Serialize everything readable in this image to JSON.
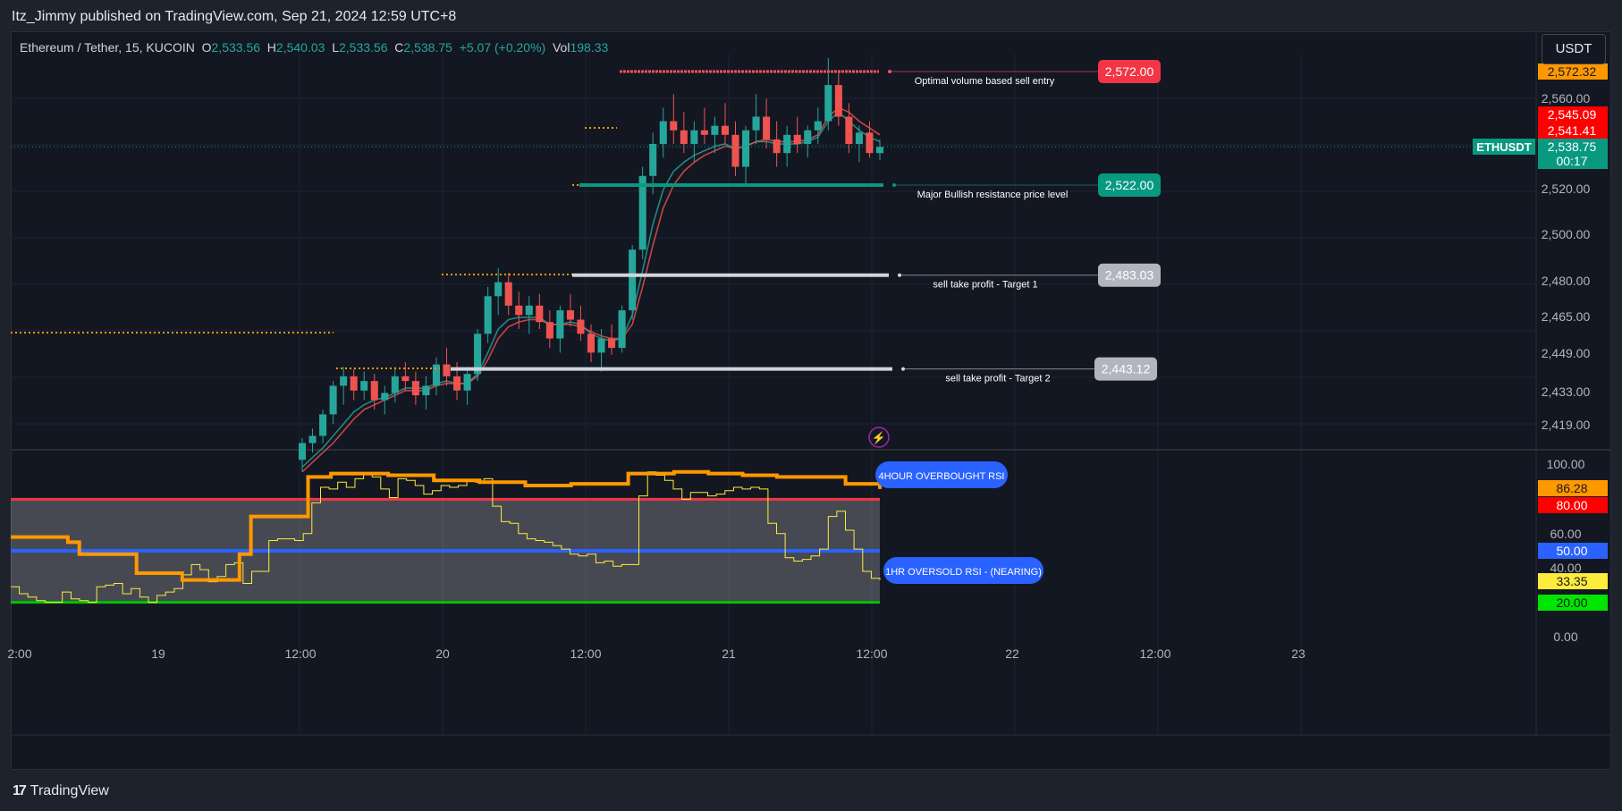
{
  "header": {
    "published": "Itz_Jimmy published on TradingView.com, Sep 21, 2024 12:59 UTC+8"
  },
  "legend": {
    "symbol": "Ethereum / Tether, 15, KUCOIN",
    "o_label": "O",
    "o": "2,533.56",
    "h_label": "H",
    "h": "2,540.03",
    "l_label": "L",
    "l": "2,533.56",
    "c_label": "C",
    "c": "2,538.75",
    "change": "+5.07 (+0.20%)",
    "vol_label": "Vol",
    "vol": "198.33"
  },
  "currency_button": "USDT",
  "symbol_tag": "ETHUSDT",
  "footer": {
    "brand": "TradingView"
  },
  "colors": {
    "up": "#26a69a",
    "down": "#ef5350",
    "orange": "#ff9800",
    "rsi_blue": "#2962ff",
    "rsi_red": "#f23645",
    "rsi_green": "#00c300"
  },
  "chart_data": {
    "type": "candlestick",
    "price_axis": {
      "ticks": [
        "2,560.00",
        "2,520.00",
        "2,500.00",
        "2,480.00",
        "2,465.00",
        "2,449.00",
        "2,433.00",
        "2,419.00"
      ],
      "scale": "log"
    },
    "price_labels": [
      {
        "text": "2,572.32",
        "bg": "#ff9800",
        "fg": "#131722"
      },
      {
        "text": "2,545.09",
        "bg": "#ff0000",
        "fg": "#ffffff"
      },
      {
        "text": "2,541.41",
        "bg": "#ff0000",
        "fg": "#ffffff"
      },
      {
        "text": "2,538.75",
        "bg": "#089981",
        "fg": "#ffffff"
      },
      {
        "text": "00:17",
        "bg": "#089981",
        "fg": "#ffffff"
      }
    ],
    "last_price": 2538.75,
    "time_axis": [
      "2:00",
      "19",
      "12:00",
      "20",
      "12:00",
      "21",
      "12:00",
      "22",
      "12:00",
      "23"
    ],
    "candles": [
      {
        "o": 2405,
        "h": 2414,
        "l": 2400,
        "c": 2412
      },
      {
        "o": 2412,
        "h": 2418,
        "l": 2408,
        "c": 2415
      },
      {
        "o": 2415,
        "h": 2426,
        "l": 2412,
        "c": 2424
      },
      {
        "o": 2424,
        "h": 2438,
        "l": 2420,
        "c": 2436
      },
      {
        "o": 2436,
        "h": 2444,
        "l": 2428,
        "c": 2440
      },
      {
        "o": 2440,
        "h": 2443,
        "l": 2430,
        "c": 2434
      },
      {
        "o": 2434,
        "h": 2442,
        "l": 2430,
        "c": 2438
      },
      {
        "o": 2438,
        "h": 2441,
        "l": 2426,
        "c": 2430
      },
      {
        "o": 2430,
        "h": 2436,
        "l": 2424,
        "c": 2433
      },
      {
        "o": 2433,
        "h": 2444,
        "l": 2429,
        "c": 2440
      },
      {
        "o": 2440,
        "h": 2446,
        "l": 2434,
        "c": 2438
      },
      {
        "o": 2438,
        "h": 2442,
        "l": 2428,
        "c": 2432
      },
      {
        "o": 2432,
        "h": 2440,
        "l": 2426,
        "c": 2436
      },
      {
        "o": 2436,
        "h": 2448,
        "l": 2432,
        "c": 2445
      },
      {
        "o": 2445,
        "h": 2452,
        "l": 2436,
        "c": 2440
      },
      {
        "o": 2440,
        "h": 2446,
        "l": 2430,
        "c": 2434
      },
      {
        "o": 2434,
        "h": 2444,
        "l": 2428,
        "c": 2441
      },
      {
        "o": 2441,
        "h": 2460,
        "l": 2438,
        "c": 2458
      },
      {
        "o": 2458,
        "h": 2478,
        "l": 2454,
        "c": 2474
      },
      {
        "o": 2474,
        "h": 2486,
        "l": 2466,
        "c": 2480
      },
      {
        "o": 2480,
        "h": 2484,
        "l": 2466,
        "c": 2470
      },
      {
        "o": 2470,
        "h": 2476,
        "l": 2460,
        "c": 2466
      },
      {
        "o": 2466,
        "h": 2474,
        "l": 2458,
        "c": 2470
      },
      {
        "o": 2470,
        "h": 2475,
        "l": 2460,
        "c": 2463
      },
      {
        "o": 2463,
        "h": 2468,
        "l": 2452,
        "c": 2456
      },
      {
        "o": 2456,
        "h": 2470,
        "l": 2450,
        "c": 2468
      },
      {
        "o": 2468,
        "h": 2475,
        "l": 2461,
        "c": 2464
      },
      {
        "o": 2464,
        "h": 2470,
        "l": 2455,
        "c": 2458
      },
      {
        "o": 2458,
        "h": 2462,
        "l": 2446,
        "c": 2450
      },
      {
        "o": 2450,
        "h": 2460,
        "l": 2442,
        "c": 2456
      },
      {
        "o": 2456,
        "h": 2462,
        "l": 2449,
        "c": 2452
      },
      {
        "o": 2452,
        "h": 2470,
        "l": 2450,
        "c": 2468
      },
      {
        "o": 2468,
        "h": 2496,
        "l": 2464,
        "c": 2494
      },
      {
        "o": 2494,
        "h": 2530,
        "l": 2490,
        "c": 2526
      },
      {
        "o": 2526,
        "h": 2545,
        "l": 2518,
        "c": 2540
      },
      {
        "o": 2540,
        "h": 2556,
        "l": 2534,
        "c": 2550
      },
      {
        "o": 2550,
        "h": 2562,
        "l": 2540,
        "c": 2546
      },
      {
        "o": 2546,
        "h": 2554,
        "l": 2536,
        "c": 2540
      },
      {
        "o": 2540,
        "h": 2550,
        "l": 2532,
        "c": 2546
      },
      {
        "o": 2546,
        "h": 2556,
        "l": 2540,
        "c": 2544
      },
      {
        "o": 2544,
        "h": 2552,
        "l": 2536,
        "c": 2548
      },
      {
        "o": 2548,
        "h": 2558,
        "l": 2540,
        "c": 2544
      },
      {
        "o": 2544,
        "h": 2550,
        "l": 2526,
        "c": 2530
      },
      {
        "o": 2530,
        "h": 2548,
        "l": 2522,
        "c": 2546
      },
      {
        "o": 2546,
        "h": 2562,
        "l": 2540,
        "c": 2552
      },
      {
        "o": 2552,
        "h": 2560,
        "l": 2538,
        "c": 2542
      },
      {
        "o": 2542,
        "h": 2550,
        "l": 2530,
        "c": 2536
      },
      {
        "o": 2536,
        "h": 2548,
        "l": 2530,
        "c": 2544
      },
      {
        "o": 2544,
        "h": 2552,
        "l": 2536,
        "c": 2540
      },
      {
        "o": 2540,
        "h": 2548,
        "l": 2534,
        "c": 2546
      },
      {
        "o": 2546,
        "h": 2556,
        "l": 2540,
        "c": 2550
      },
      {
        "o": 2550,
        "h": 2578,
        "l": 2546,
        "c": 2566
      },
      {
        "o": 2566,
        "h": 2572,
        "l": 2548,
        "c": 2552
      },
      {
        "o": 2552,
        "h": 2558,
        "l": 2536,
        "c": 2540
      },
      {
        "o": 2540,
        "h": 2548,
        "l": 2532,
        "c": 2545
      },
      {
        "o": 2545,
        "h": 2550,
        "l": 2534,
        "c": 2536
      },
      {
        "o": 2536,
        "h": 2542,
        "l": 2533,
        "c": 2538.75
      }
    ],
    "ma_lines": [
      {
        "name": "",
        "color": "#26a69a",
        "values": [
          2402,
          2406,
          2410,
          2415,
          2420,
          2425,
          2428,
          2430,
          2431,
          2433,
          2435,
          2435,
          2435,
          2437,
          2438,
          2437,
          2437,
          2441,
          2450,
          2460,
          2464,
          2465,
          2465,
          2465,
          2462,
          2462,
          2463,
          2462,
          2458,
          2456,
          2455,
          2456,
          2466,
          2485,
          2505,
          2520,
          2528,
          2532,
          2535,
          2537,
          2539,
          2540,
          2538,
          2539,
          2541,
          2541,
          2540,
          2540,
          2540,
          2541,
          2543,
          2550,
          2554,
          2550,
          2546,
          2543,
          2541
        ]
      },
      {
        "name": "",
        "color": "#ef5350",
        "values": [
          2400,
          2404,
          2408,
          2412,
          2417,
          2422,
          2426,
          2428,
          2430,
          2432,
          2434,
          2434,
          2434,
          2436,
          2437,
          2437,
          2437,
          2440,
          2447,
          2456,
          2461,
          2463,
          2464,
          2464,
          2462,
          2462,
          2462,
          2461,
          2459,
          2457,
          2456,
          2456,
          2462,
          2478,
          2496,
          2512,
          2522,
          2528,
          2532,
          2535,
          2537,
          2539,
          2538,
          2539,
          2541,
          2542,
          2541,
          2541,
          2541,
          2542,
          2544,
          2552,
          2556,
          2554,
          2550,
          2547,
          2544
        ]
      }
    ],
    "horizontal_levels": [
      {
        "price": 2572.0,
        "label": "2,572.00",
        "text": "Optimal volume based sell entry",
        "color": "#f23645",
        "line": "#f7525f"
      },
      {
        "price": 2522.0,
        "label": "2,522.00",
        "text": "Major Bullish resistance price level",
        "color": "#089981",
        "line": "#089981"
      },
      {
        "price": 2483.03,
        "label": "2,483.03",
        "text": "sell take profit - Target 1",
        "color": "#b2b5be",
        "line": "#d1d4dc"
      },
      {
        "price": 2443.12,
        "label": "2,443.12",
        "text": "sell take profit - Target 2",
        "color": "#b2b5be",
        "line": "#d1d4dc"
      }
    ],
    "rsi_pane": {
      "axis_ticks": [
        "100.00",
        "60.00",
        "40.00",
        "0.00"
      ],
      "labels": [
        {
          "text": "86.28",
          "bg": "#ff9800",
          "fg": "#131722",
          "value": 86.28
        },
        {
          "text": "80.00",
          "bg": "#ff0000",
          "fg": "#ffffff",
          "value": 80
        },
        {
          "text": "50.00",
          "bg": "#2962ff",
          "fg": "#ffffff",
          "value": 50
        },
        {
          "text": "33.35",
          "bg": "#ffeb3b",
          "fg": "#131722",
          "value": 33.35
        },
        {
          "text": "20.00",
          "bg": "#00e600",
          "fg": "#131722",
          "value": 20
        }
      ],
      "upper_band": 80,
      "lower_band": 20,
      "mid": 50,
      "rsi_4h": [
        58,
        58,
        58,
        58,
        58,
        55,
        48,
        48,
        48,
        48,
        48,
        37,
        37,
        37,
        37,
        33,
        33,
        33,
        33,
        33,
        48,
        70,
        70,
        70,
        70,
        70,
        93,
        93,
        95,
        95,
        95,
        95,
        95,
        94,
        94,
        94,
        94,
        91,
        91,
        91,
        91,
        90,
        90,
        90,
        90,
        88,
        88,
        88,
        88,
        89,
        89,
        89,
        89,
        89,
        95,
        95,
        95,
        95,
        96,
        96,
        96,
        95,
        95,
        95,
        94,
        94,
        94,
        93,
        93,
        93,
        93,
        93,
        93,
        89,
        89,
        89,
        86
      ],
      "rsi_1h": [
        29,
        25,
        23,
        21,
        20,
        20,
        26,
        22,
        21,
        20,
        29,
        30,
        31,
        25,
        28,
        23,
        20,
        24,
        26,
        28,
        36,
        42,
        39,
        32,
        35,
        42,
        43,
        31,
        38,
        38,
        56,
        57,
        57,
        56,
        60,
        78,
        87,
        86,
        90,
        87,
        92,
        95,
        93,
        86,
        81,
        92,
        91,
        88,
        83,
        85,
        88,
        87,
        88,
        91,
        90,
        92,
        76,
        67,
        66,
        60,
        57,
        56,
        55,
        53,
        51,
        48,
        47,
        48,
        43,
        44,
        41,
        42,
        42,
        82,
        96,
        94,
        91,
        86,
        80,
        84,
        84,
        82,
        83,
        85,
        87,
        86,
        87,
        86,
        66,
        60,
        46,
        44,
        45,
        47,
        51,
        70,
        73,
        62,
        51,
        38,
        34,
        33
      ]
    }
  }
}
